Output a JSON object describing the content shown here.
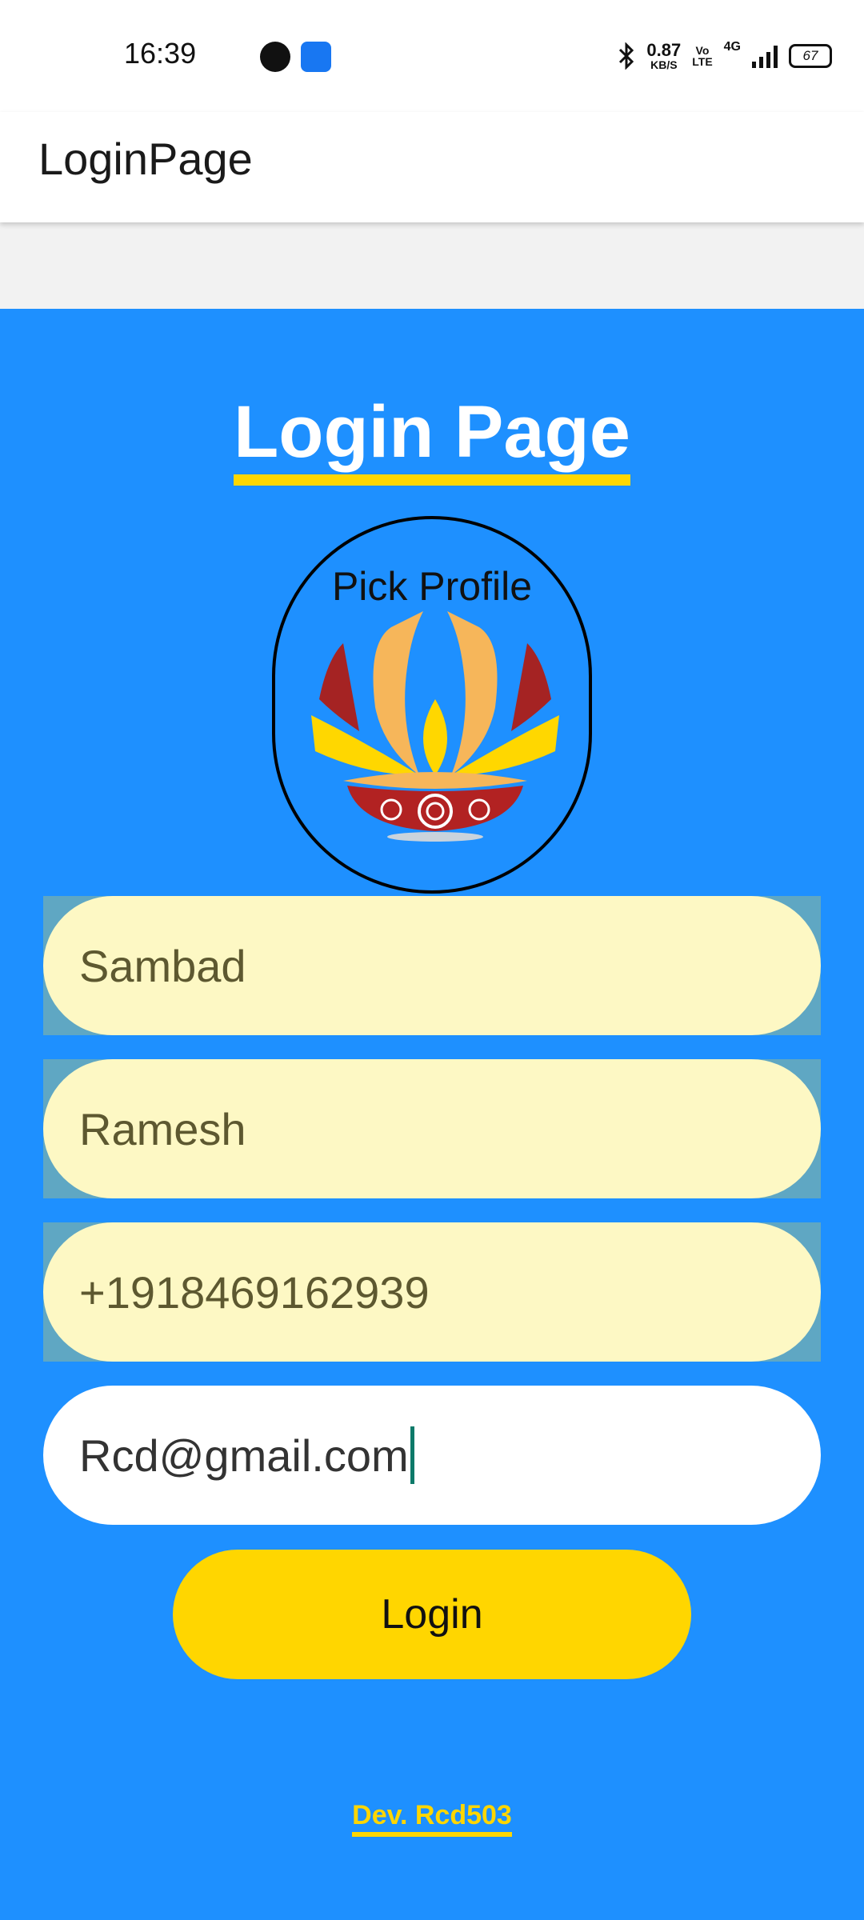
{
  "status_bar": {
    "time": "16:39",
    "net_speed_value": "0.87",
    "net_speed_unit": "KB/S",
    "volte_top": "Vo",
    "volte_bottom": "LTE",
    "network": "4G",
    "battery": "67",
    "icons": [
      "bluetooth-icon",
      "signal-icon",
      "battery-icon"
    ]
  },
  "app_bar": {
    "title": "LoginPage"
  },
  "main": {
    "heading": "Login Page",
    "profile_label": "Pick Profile",
    "fields": [
      {
        "value": "Sambad"
      },
      {
        "value": "Ramesh"
      },
      {
        "value": "+1918469162939"
      },
      {
        "value": "Rcd@gmail.com"
      }
    ],
    "login_label": "Login",
    "dev_credit": "Dev. Rcd503"
  },
  "colors": {
    "background": "#1e90ff",
    "accent": "#ffd600",
    "field_fill": "#fdf8c4"
  }
}
